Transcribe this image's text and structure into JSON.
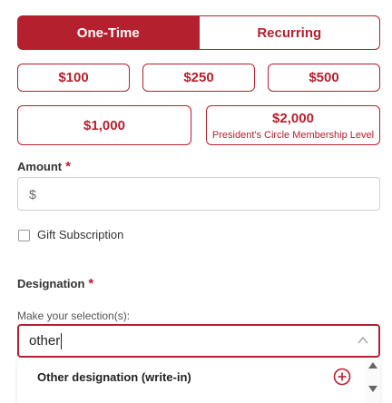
{
  "tabs": [
    {
      "label": "One-Time",
      "active": true
    },
    {
      "label": "Recurring",
      "active": false
    }
  ],
  "amounts": [
    {
      "value": "$100"
    },
    {
      "value": "$250"
    },
    {
      "value": "$500"
    },
    {
      "value": "$1,000"
    },
    {
      "value": "$2,000",
      "sublabel": "President's Circle Membership Level"
    }
  ],
  "amount_field": {
    "label": "Amount",
    "required_mark": "*",
    "prefix": "$"
  },
  "gift_subscription": {
    "label": "Gift Subscription",
    "checked": false
  },
  "designation": {
    "label": "Designation",
    "required_mark": "*",
    "hint": "Make your selection(s):",
    "search_value": "other",
    "options": [
      {
        "label": "Other designation (write-in)"
      }
    ]
  },
  "colors": {
    "accent": "#b5202e"
  },
  "icons": {
    "chevron": "chevron-up-icon",
    "add": "plus-circle-icon"
  }
}
